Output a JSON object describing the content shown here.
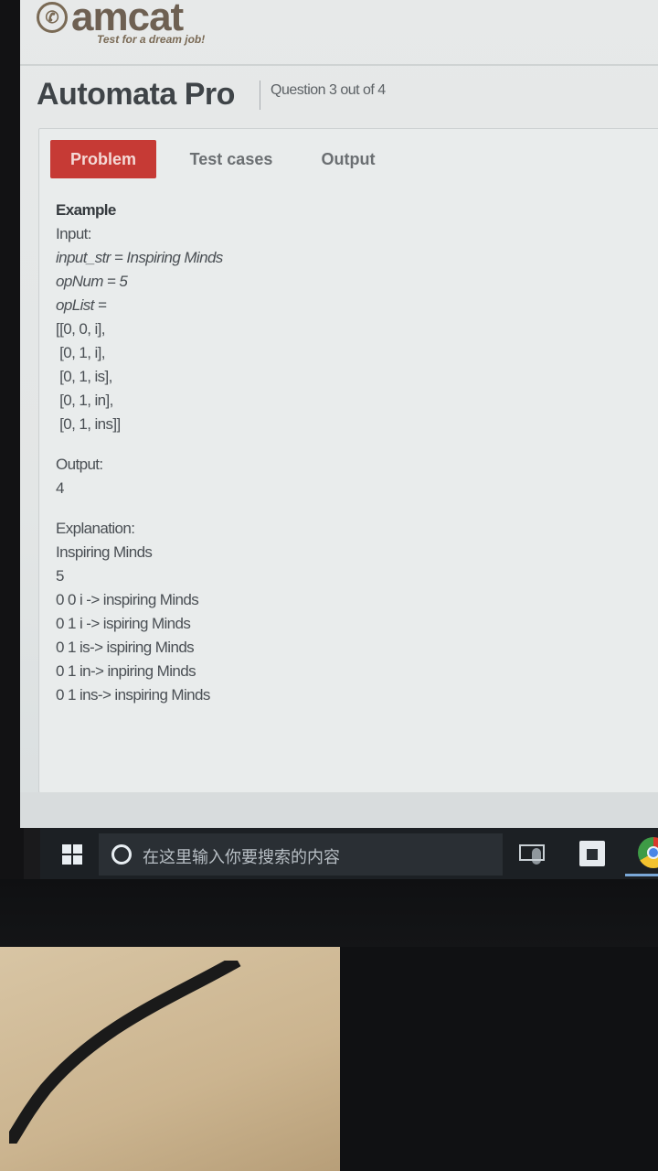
{
  "brand": {
    "logo_text": "amcat",
    "tagline": "Test for a dream job!"
  },
  "header": {
    "app_title": "Automata Pro",
    "question_counter": "Question 3 out of 4"
  },
  "tabs": [
    {
      "label": "Problem",
      "active": true
    },
    {
      "label": "Test cases",
      "active": false
    },
    {
      "label": "Output",
      "active": false
    }
  ],
  "problem": {
    "example_heading": "Example",
    "input_label": "Input:",
    "input_lines": [
      "input_str = Inspiring Minds",
      "opNum = 5",
      "opList ="
    ],
    "oplist_lines": [
      "[[0, 0, i],",
      " [0, 1, i],",
      " [0, 1, is],",
      " [0, 1, in],",
      " [0, 1, ins]]"
    ],
    "output_label": "Output:",
    "output_value": "4",
    "explanation_label": "Explanation:",
    "explanation_lines": [
      "Inspiring Minds",
      "5",
      "0 0 i -> inspiring Minds",
      "0 1 i -> ispiring Minds",
      "0 1 is-> ispiring Minds",
      "0 1 in-> inpiring Minds",
      "0 1 ins-> inspiring Minds"
    ]
  },
  "taskbar": {
    "search_placeholder": "在这里输入你要搜索的内容",
    "icons": [
      "windows-start-icon",
      "cortana-icon",
      "microphone-icon",
      "task-view-icon",
      "store-icon",
      "chrome-icon"
    ]
  },
  "colors": {
    "active_tab": "#c63a35",
    "taskbar": "#1c2024"
  }
}
